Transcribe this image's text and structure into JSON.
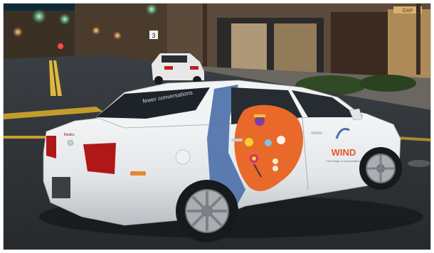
{
  "photo": {
    "window_text": "fewer conversations",
    "trunk_badge": "Malibu",
    "logo_text": "WIND",
    "tagline": "The shape of conversations",
    "shop_sign": "GAP",
    "road_sign": "3"
  },
  "colors": {
    "car_body": "#eceef0",
    "wrap_blue": "#4a6fa8",
    "wrap_orange": "#e8692a",
    "logo_orange": "#e4572e",
    "street_light": "#48e08a",
    "tail_light": "#b01818"
  }
}
